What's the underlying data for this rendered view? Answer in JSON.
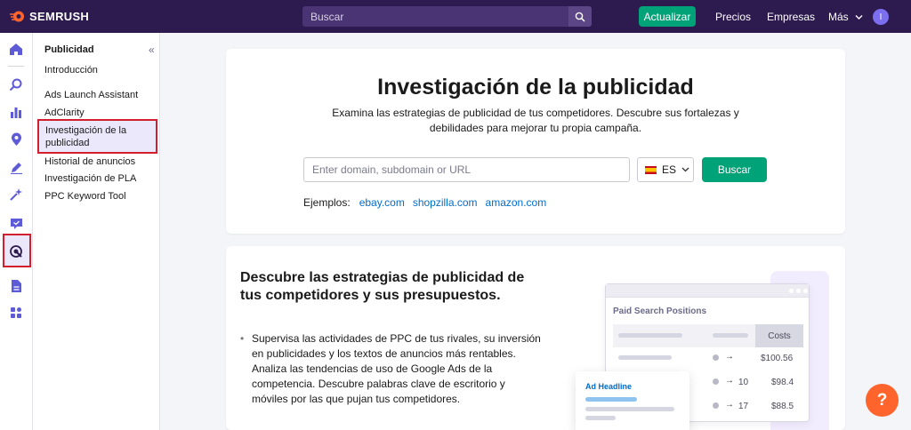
{
  "header": {
    "brand": "SEMRUSH",
    "search_placeholder": "Buscar",
    "upgrade_label": "Actualizar",
    "nav": [
      "Precios",
      "Empresas",
      "Más"
    ],
    "avatar_initial": "I",
    "colors": {
      "bar": "#2d1a4f",
      "accent": "#00a277",
      "logo": "#ff642d"
    }
  },
  "rail": {
    "icons": [
      "home-icon",
      "seo-icon",
      "chart-icon",
      "location-pin-icon",
      "pen-icon",
      "sparkle-icon",
      "chat-icon",
      "advertising-target-icon",
      "document-icon",
      "apps-grid-icon"
    ],
    "active": "advertising-target-icon"
  },
  "submenu": {
    "title": "Publicidad",
    "items": [
      "Introducción",
      "Ads Launch Assistant",
      "AdClarity",
      "Investigación de la publicidad",
      "Historial de anuncios",
      "Investigación de PLA",
      "PPC Keyword Tool"
    ],
    "active_index": 3
  },
  "hero": {
    "title": "Investigación de la publicidad",
    "description": "Examina las estrategias de publicidad de tus competidores. Descubre sus fortalezas y debilidades para mejorar tu propia campaña.",
    "domain_placeholder": "Enter domain, subdomain or URL",
    "database": "ES",
    "search_label": "Buscar",
    "examples_label": "Ejemplos:",
    "examples": [
      "ebay.com",
      "shopzilla.com",
      "amazon.com"
    ]
  },
  "promo": {
    "title": "Descubre las estrategias de publicidad de tus competidores y sus presupuestos.",
    "bullet": "Supervisa las actividades de PPC de tus rivales, su inversión en publicidades y los textos de anuncios más rentables. Analiza las tendencias de uso de Google Ads de la competencia. Descubre palabras clave de escritorio y móviles por las que pujan tus competidores.",
    "mock": {
      "title": "Paid Search Positions",
      "costs_header": "Costs",
      "rows": [
        {
          "position": "",
          "cost": "$100.56"
        },
        {
          "position": "10",
          "cost": "$98.4"
        },
        {
          "position": "17",
          "cost": "$88.5"
        }
      ],
      "ad_headline": "Ad Headline"
    }
  },
  "help_label": "?"
}
